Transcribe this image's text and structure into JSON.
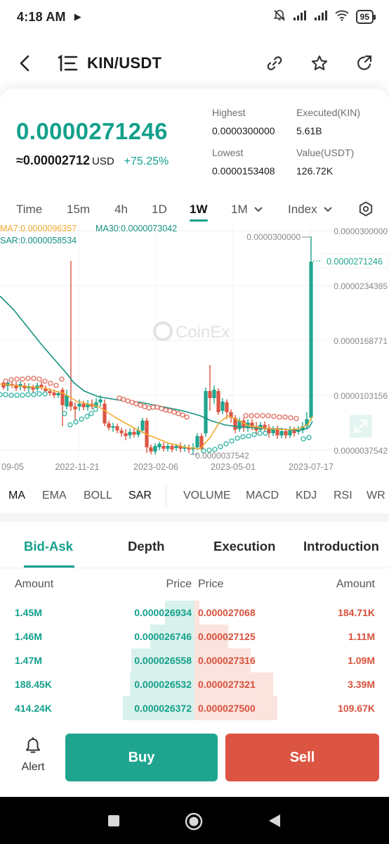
{
  "status_bar": {
    "time": "4:18 AM",
    "play_icon": "play-icon",
    "battery": "95",
    "icons": [
      "muted-bell-icon",
      "signal-icon",
      "signal-icon",
      "wifi-icon",
      "battery-icon"
    ]
  },
  "header": {
    "pair": "KIN/USDT",
    "icons": [
      "back-arrow-icon",
      "menu-list-icon",
      "link-icon",
      "star-icon",
      "share-icon"
    ]
  },
  "ticker": {
    "last_price": "0.0000271246",
    "usd_approx": "≈0.00002712",
    "usd_unit": "USD",
    "change": "+75.25%",
    "highest_label": "Highest",
    "highest_value": "0.0000300000",
    "executed_label": "Executed(KIN)",
    "executed_value": "5.61B",
    "lowest_label": "Lowest",
    "lowest_value": "0.0000153408",
    "value_label": "Value(USDT)",
    "value_value": "126.72K"
  },
  "timeframes": {
    "time": "Time",
    "m15": "15m",
    "h4": "4h",
    "d1": "1D",
    "w1": "1W",
    "mo1": "1M",
    "index": "Index",
    "selected": "1W"
  },
  "chart": {
    "ma7_label": "MA7:0.0000096357",
    "ma30_label": "MA30:0.0000073042",
    "sar_label": "SAR:0.0000058534",
    "y_ticks": [
      "0.0000300000",
      "0.0000234385",
      "0.0000168771",
      "0.0000103156",
      "0.0000037542"
    ],
    "x_ticks": [
      "09-05",
      "2022-11-21",
      "2023-02-06",
      "2023-05-01",
      "2023-07-17"
    ],
    "current_price_tag": "0.0000271246",
    "max_annotation": "0.0000300000",
    "min_annotation": "0.0000037542",
    "watermark": "CoinEx",
    "colors": {
      "up": "#1fa58f",
      "down": "#dc5542",
      "ma7": "#f0a92f",
      "ma30": "#15917f",
      "sar_up": "#2bb3a0",
      "sar_down": "#e06a5a"
    }
  },
  "indicators": {
    "ma": "MA",
    "ema": "EMA",
    "boll": "BOLL",
    "sar": "SAR",
    "volume": "VOLUME",
    "macd": "MACD",
    "kdj": "KDJ",
    "rsi": "RSI",
    "wr": "WR"
  },
  "sections": {
    "bid_ask": "Bid-Ask",
    "depth": "Depth",
    "execution": "Execution",
    "introduction": "Introduction"
  },
  "orderbook": {
    "headers": {
      "amount_left": "Amount",
      "price_left": "Price",
      "price_right": "Price",
      "amount_right": "Amount"
    },
    "rows": [
      {
        "bid_amount": "1.45M",
        "bid_price": "0.000026934",
        "ask_price": "0.000027068",
        "ask_amount": "184.71K",
        "bid_depth": 0.3,
        "ask_depth": 0.05
      },
      {
        "bid_amount": "1.46M",
        "bid_price": "0.000026746",
        "ask_price": "0.000027125",
        "ask_amount": "1.11M",
        "bid_depth": 0.45,
        "ask_depth": 0.34
      },
      {
        "bid_amount": "1.47M",
        "bid_price": "0.000026558",
        "ask_price": "0.000027316",
        "ask_amount": "1.09M",
        "bid_depth": 0.64,
        "ask_depth": 0.57
      },
      {
        "bid_amount": "188.45K",
        "bid_price": "0.000026532",
        "ask_price": "0.000027321",
        "ask_amount": "3.39M",
        "bid_depth": 0.66,
        "ask_depth": 0.8
      },
      {
        "bid_amount": "414.24K",
        "bid_price": "0.000026372",
        "ask_price": "0.000027500",
        "ask_amount": "109.67K",
        "bid_depth": 0.73,
        "ask_depth": 0.84
      }
    ]
  },
  "actions": {
    "alert": "Alert",
    "buy": "Buy",
    "sell": "Sell"
  }
}
